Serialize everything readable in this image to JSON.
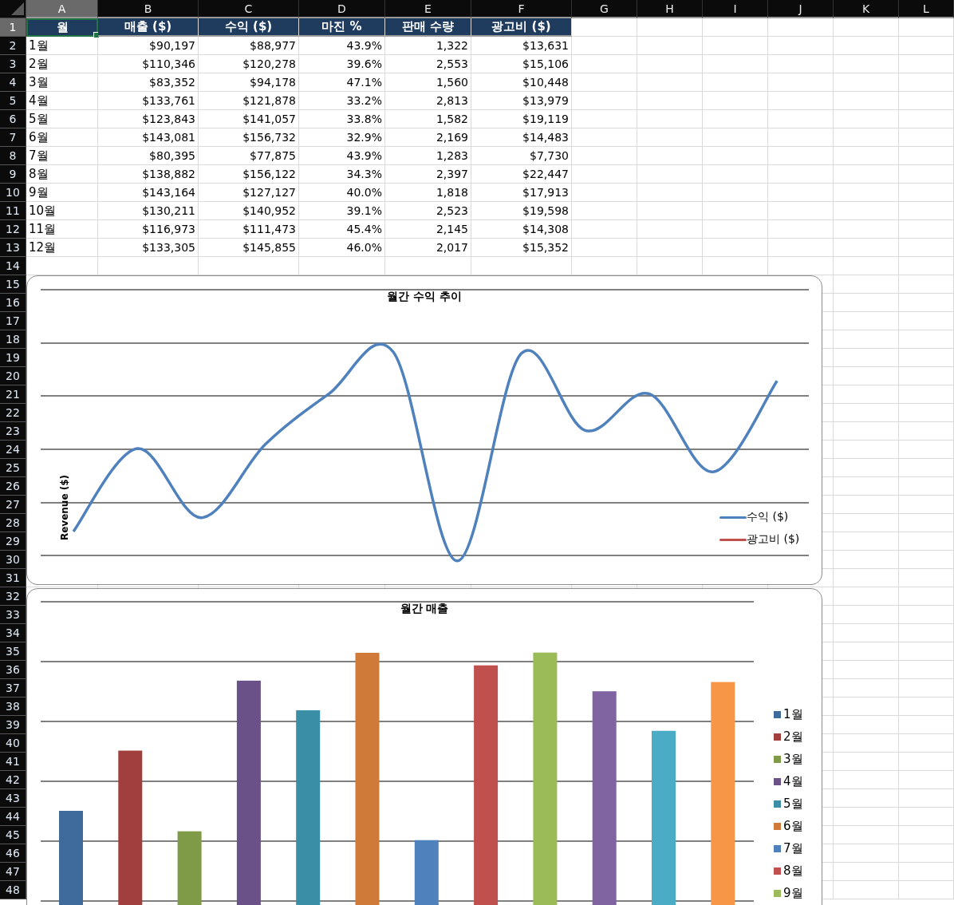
{
  "columns": [
    {
      "label": "A",
      "selected": true
    },
    {
      "label": "B",
      "selected": false
    },
    {
      "label": "C",
      "selected": false
    },
    {
      "label": "D",
      "selected": false
    },
    {
      "label": "E",
      "selected": false
    },
    {
      "label": "F",
      "selected": false
    },
    {
      "label": "G",
      "selected": false
    },
    {
      "label": "H",
      "selected": false
    },
    {
      "label": "I",
      "selected": false
    },
    {
      "label": "J",
      "selected": false
    },
    {
      "label": "K",
      "selected": false
    },
    {
      "label": "L",
      "selected": false
    }
  ],
  "row_numbers": [
    {
      "label": "1",
      "selected": true
    },
    {
      "label": "2",
      "selected": false
    },
    {
      "label": "3",
      "selected": false
    },
    {
      "label": "4",
      "selected": false
    },
    {
      "label": "5",
      "selected": false
    },
    {
      "label": "6",
      "selected": false
    },
    {
      "label": "7",
      "selected": false
    },
    {
      "label": "8",
      "selected": false
    },
    {
      "label": "9",
      "selected": false
    },
    {
      "label": "10",
      "selected": false
    },
    {
      "label": "11",
      "selected": false
    },
    {
      "label": "12",
      "selected": false
    },
    {
      "label": "13",
      "selected": false
    },
    {
      "label": "14",
      "selected": false
    },
    {
      "label": "15",
      "selected": false
    },
    {
      "label": "16",
      "selected": false
    },
    {
      "label": "17",
      "selected": false
    },
    {
      "label": "18",
      "selected": false
    },
    {
      "label": "19",
      "selected": false
    },
    {
      "label": "20",
      "selected": false
    },
    {
      "label": "21",
      "selected": false
    },
    {
      "label": "22",
      "selected": false
    },
    {
      "label": "23",
      "selected": false
    },
    {
      "label": "24",
      "selected": false
    },
    {
      "label": "25",
      "selected": false
    },
    {
      "label": "26",
      "selected": false
    },
    {
      "label": "27",
      "selected": false
    },
    {
      "label": "28",
      "selected": false
    },
    {
      "label": "29",
      "selected": false
    },
    {
      "label": "30",
      "selected": false
    },
    {
      "label": "31",
      "selected": false
    },
    {
      "label": "32",
      "selected": false
    },
    {
      "label": "33",
      "selected": false
    },
    {
      "label": "34",
      "selected": false
    },
    {
      "label": "35",
      "selected": false
    },
    {
      "label": "36",
      "selected": false
    },
    {
      "label": "37",
      "selected": false
    },
    {
      "label": "38",
      "selected": false
    },
    {
      "label": "39",
      "selected": false
    },
    {
      "label": "40",
      "selected": false
    },
    {
      "label": "41",
      "selected": false
    },
    {
      "label": "42",
      "selected": false
    },
    {
      "label": "43",
      "selected": false
    },
    {
      "label": "44",
      "selected": false
    },
    {
      "label": "45",
      "selected": false
    },
    {
      "label": "46",
      "selected": false
    },
    {
      "label": "47",
      "selected": false
    },
    {
      "label": "48",
      "selected": false
    }
  ],
  "table": {
    "header": [
      {
        "text": "월",
        "selected": true
      },
      {
        "text": "매출 ($)",
        "selected": false
      },
      {
        "text": "수익 ($)",
        "selected": false
      },
      {
        "text": "마진 %",
        "selected": false
      },
      {
        "text": "판매 수량",
        "selected": false
      },
      {
        "text": "광고비 ($)",
        "selected": false
      }
    ],
    "rows": [
      [
        "1월",
        "$90,197",
        "$88,977",
        "43.9%",
        "1,322",
        "$13,631"
      ],
      [
        "2월",
        "$110,346",
        "$120,278",
        "39.6%",
        "2,553",
        "$15,106"
      ],
      [
        "3월",
        "$83,352",
        "$94,178",
        "47.1%",
        "1,560",
        "$10,448"
      ],
      [
        "4월",
        "$133,761",
        "$121,878",
        "33.2%",
        "2,813",
        "$13,979"
      ],
      [
        "5월",
        "$123,843",
        "$141,057",
        "33.8%",
        "1,582",
        "$19,119"
      ],
      [
        "6월",
        "$143,081",
        "$156,732",
        "32.9%",
        "2,169",
        "$14,483"
      ],
      [
        "7월",
        "$80,395",
        "$77,875",
        "43.9%",
        "1,283",
        "$7,730"
      ],
      [
        "8월",
        "$138,882",
        "$156,122",
        "34.3%",
        "2,397",
        "$22,447"
      ],
      [
        "9월",
        "$143,164",
        "$127,127",
        "40.0%",
        "1,818",
        "$17,913"
      ],
      [
        "10월",
        "$130,211",
        "$140,952",
        "39.1%",
        "2,523",
        "$19,598"
      ],
      [
        "11월",
        "$116,973",
        "$111,473",
        "45.4%",
        "2,145",
        "$14,308"
      ],
      [
        "12월",
        "$133,305",
        "$145,855",
        "46.0%",
        "2,017",
        "$15,352"
      ]
    ]
  },
  "line_chart": {
    "title": "월간 수익 추이",
    "ylabel": "Revenue ($)",
    "legend": [
      {
        "label": "수익 ($)",
        "color": "#4f81bd"
      },
      {
        "label": "광고비 ($)",
        "color": "#c0504d"
      }
    ]
  },
  "bar_chart": {
    "title": "월간 매출",
    "legend": [
      {
        "label": "1월",
        "color": "#3e6a9c"
      },
      {
        "label": "2월",
        "color": "#a03f3d"
      },
      {
        "label": "3월",
        "color": "#7f9b47"
      },
      {
        "label": "4월",
        "color": "#6a5187"
      },
      {
        "label": "5월",
        "color": "#3a8ea5"
      },
      {
        "label": "6월",
        "color": "#cf7a39"
      },
      {
        "label": "7월",
        "color": "#4f81bd"
      },
      {
        "label": "8월",
        "color": "#c0504d"
      },
      {
        "label": "9월",
        "color": "#9bbb59"
      }
    ]
  }
}
